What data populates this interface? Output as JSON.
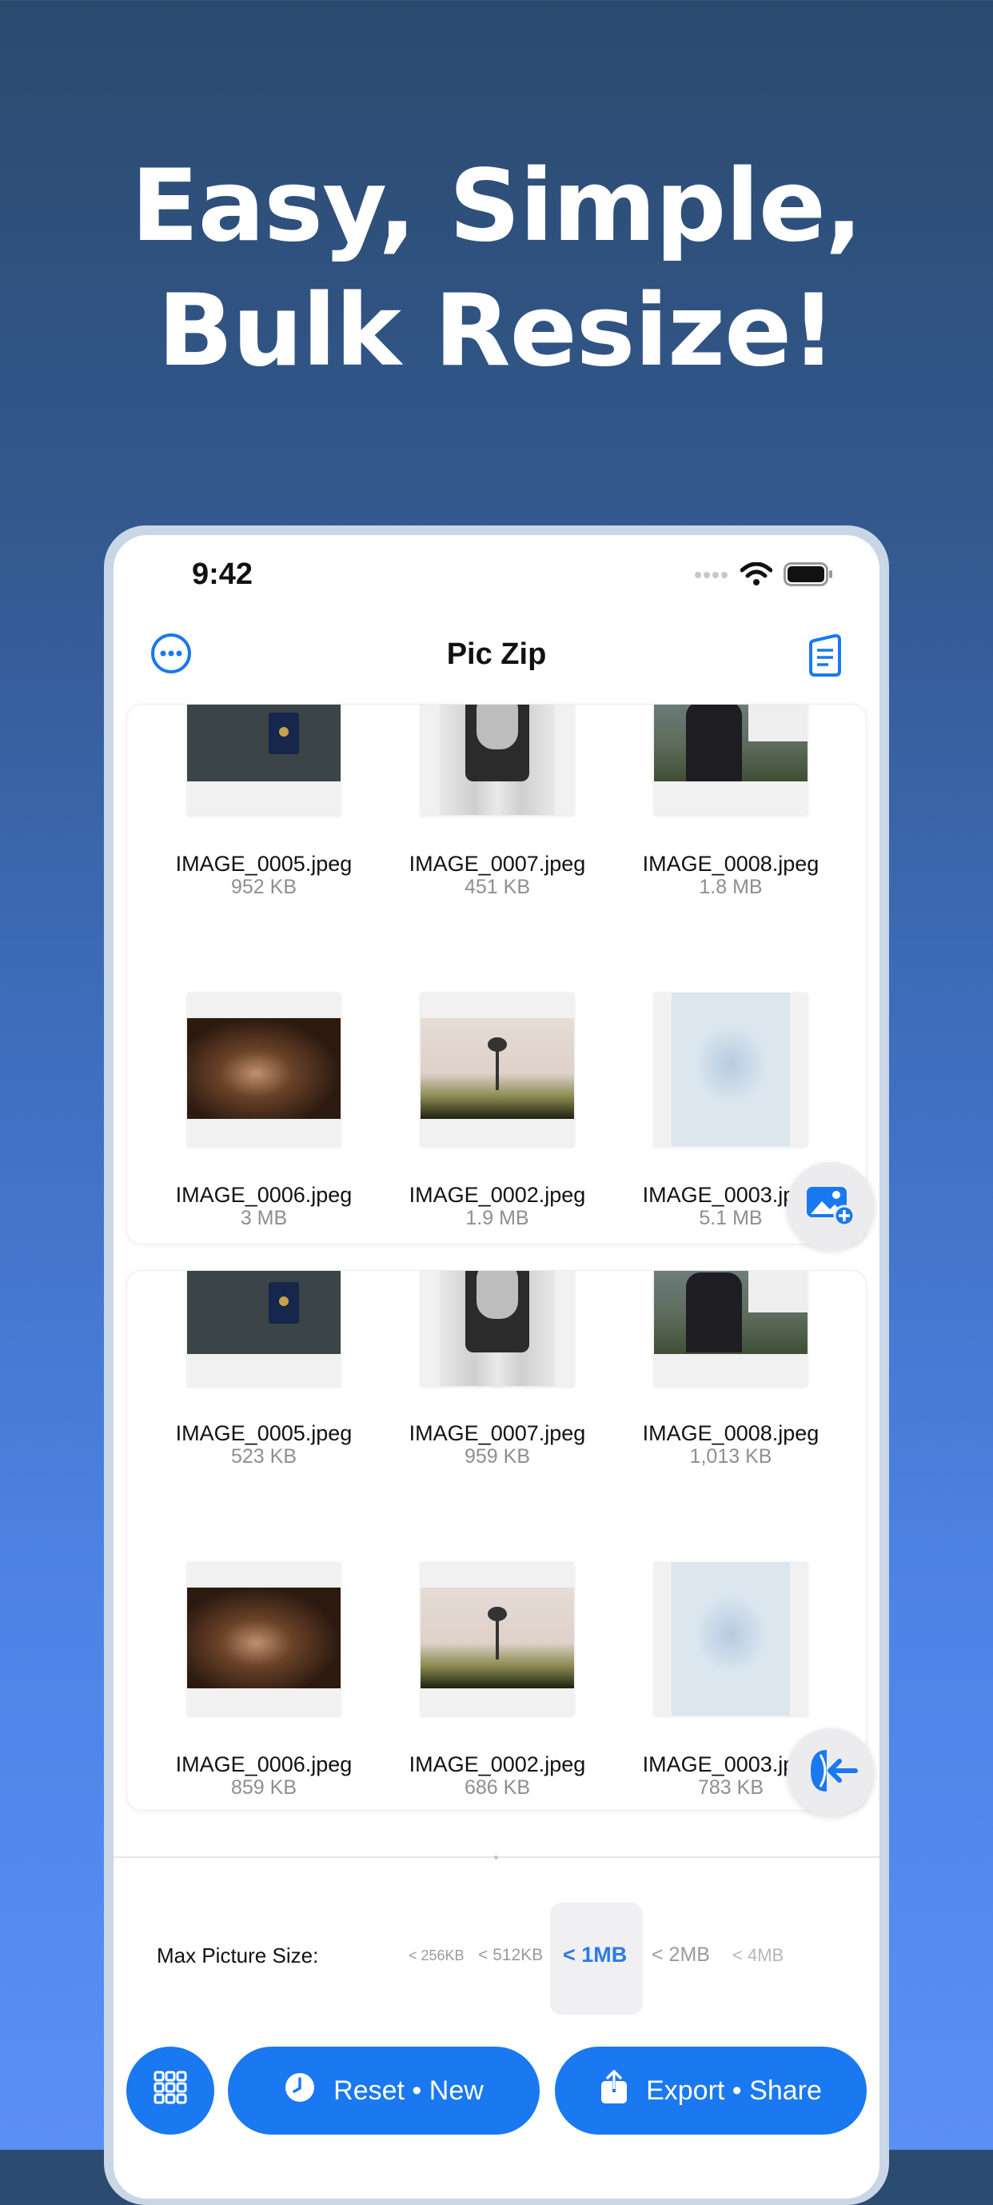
{
  "headline": {
    "line1": "Easy, Simple,",
    "line2": "Bulk Resize!"
  },
  "status": {
    "time": "9:42"
  },
  "nav": {
    "title": "Pic Zip",
    "left_icon": "more-circle-icon",
    "right_icon": "document-icon"
  },
  "top_card": {
    "files": [
      {
        "name": "IMAGE_0005.jpeg",
        "size": "952 KB"
      },
      {
        "name": "IMAGE_0007.jpeg",
        "size": "451 KB"
      },
      {
        "name": "IMAGE_0008.jpeg",
        "size": "1.8 MB"
      },
      {
        "name": "IMAGE_0006.jpeg",
        "size": "3 MB"
      },
      {
        "name": "IMAGE_0002.jpeg",
        "size": "1.9 MB"
      },
      {
        "name": "IMAGE_0003.jpeg",
        "size": "5.1 MB"
      }
    ],
    "fab_icon": "add-photo-icon"
  },
  "bottom_card": {
    "files": [
      {
        "name": "IMAGE_0005.jpeg",
        "size": "523 KB"
      },
      {
        "name": "IMAGE_0007.jpeg",
        "size": "959 KB"
      },
      {
        "name": "IMAGE_0008.jpeg",
        "size": "1,013 KB"
      },
      {
        "name": "IMAGE_0006.jpeg",
        "size": "859 KB"
      },
      {
        "name": "IMAGE_0002.jpeg",
        "size": "686 KB"
      },
      {
        "name": "IMAGE_0003.jpeg",
        "size": "783 KB"
      }
    ],
    "fab_icon": "compress-icon"
  },
  "size_picker": {
    "label": "Max Picture Size:",
    "options": [
      "< 256KB",
      "< 512KB",
      "< 1MB",
      "< 2MB",
      "< 4MB"
    ],
    "selected": "< 1MB"
  },
  "buttons": {
    "grid_icon": "grid-icon",
    "reset": "Reset • New",
    "export": "Export • Share"
  },
  "colors": {
    "accent": "#1a78f0",
    "selected_text": "#2a7be4"
  }
}
